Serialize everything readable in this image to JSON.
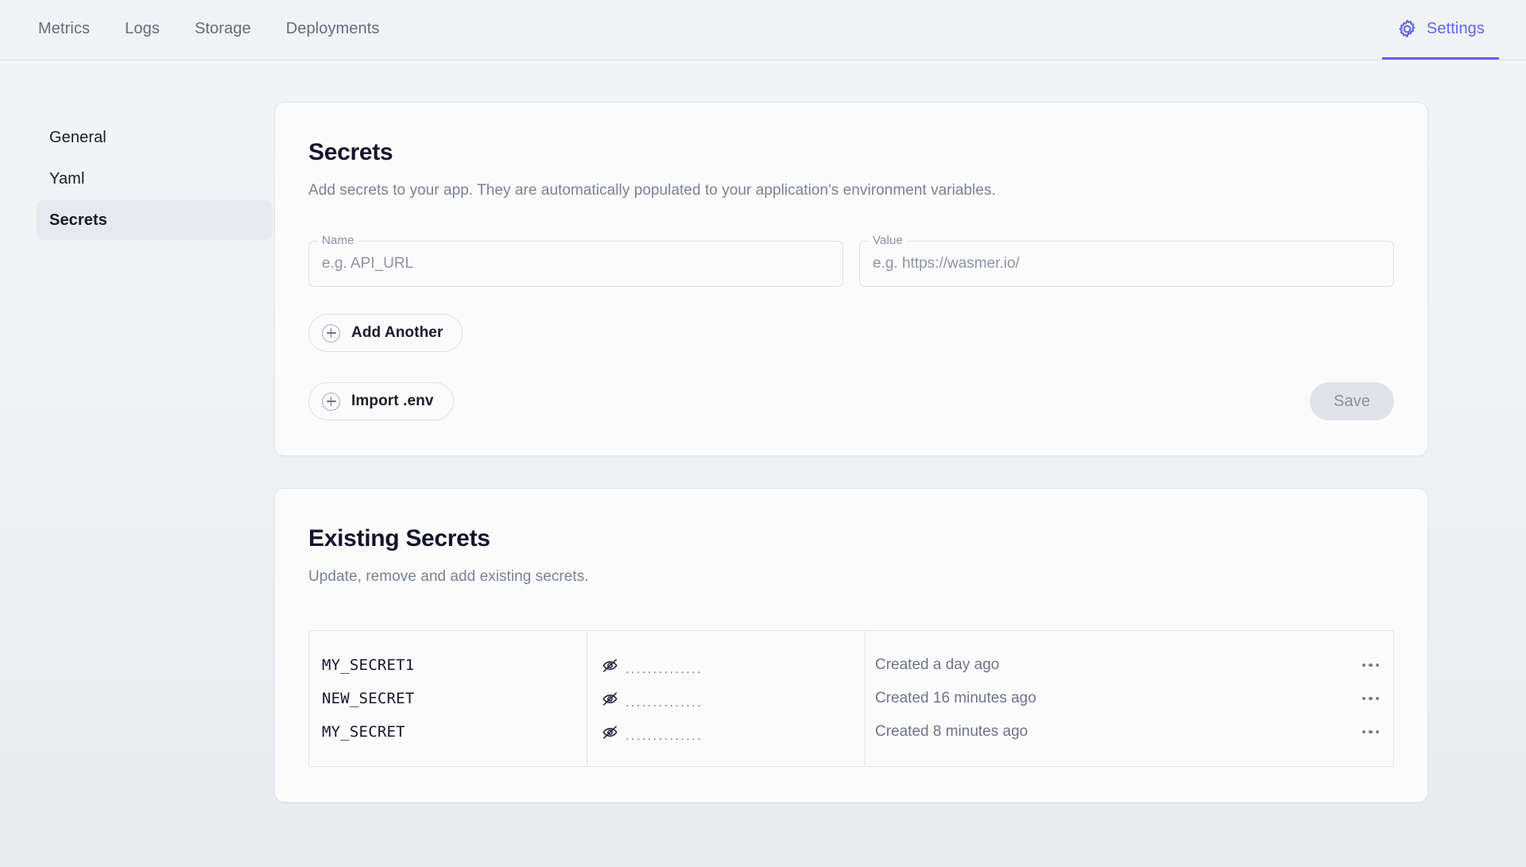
{
  "topbar": {
    "tabs": [
      {
        "label": "Metrics",
        "active": false
      },
      {
        "label": "Logs",
        "active": false
      },
      {
        "label": "Storage",
        "active": false
      },
      {
        "label": "Deployments",
        "active": false
      }
    ],
    "settings": {
      "label": "Settings",
      "icon": "gear-icon",
      "active": true,
      "color": "#6366e8"
    }
  },
  "sidebar": {
    "items": [
      {
        "label": "General",
        "selected": false
      },
      {
        "label": "Yaml",
        "selected": false
      },
      {
        "label": "Secrets",
        "selected": true
      }
    ]
  },
  "secrets_card": {
    "title": "Secrets",
    "description": "Add secrets to your app. They are automatically populated to your application's environment variables.",
    "name_field": {
      "legend": "Name",
      "value": "",
      "placeholder": "e.g. API_URL"
    },
    "value_field": {
      "legend": "Value",
      "value": "",
      "placeholder": "e.g. https://wasmer.io/"
    },
    "add_another_label": "Add Another",
    "import_env_label": "Import .env",
    "save_label": "Save",
    "save_disabled": true
  },
  "existing_card": {
    "title": "Existing Secrets",
    "description": "Update, remove and add existing secrets.",
    "rows": [
      {
        "name": "MY_SECRET1",
        "masked_value": "..............",
        "created": "Created a day ago",
        "menu": "row-menu-icon"
      },
      {
        "name": "NEW_SECRET",
        "masked_value": "..............",
        "created": "Created 16 minutes ago",
        "menu": "row-menu-icon"
      },
      {
        "name": "MY_SECRET",
        "masked_value": "..............",
        "created": "Created 8 minutes ago",
        "menu": "row-menu-icon"
      }
    ]
  }
}
